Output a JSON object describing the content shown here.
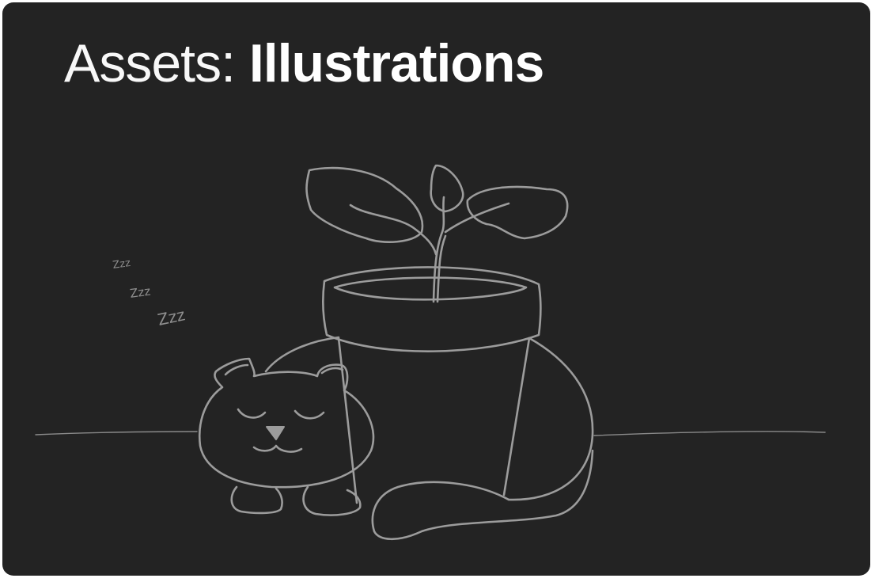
{
  "header": {
    "prefix": "Assets:",
    "name": "Illustrations"
  },
  "illustration": {
    "subject": "sleeping cat curled around a potted plant",
    "zzz": [
      "Zzz",
      "Zzz",
      "Zzz"
    ]
  },
  "colors": {
    "background": "#232323",
    "frame": "#ffffff",
    "title": "#ffffff",
    "stroke": "#9c9c9c"
  }
}
